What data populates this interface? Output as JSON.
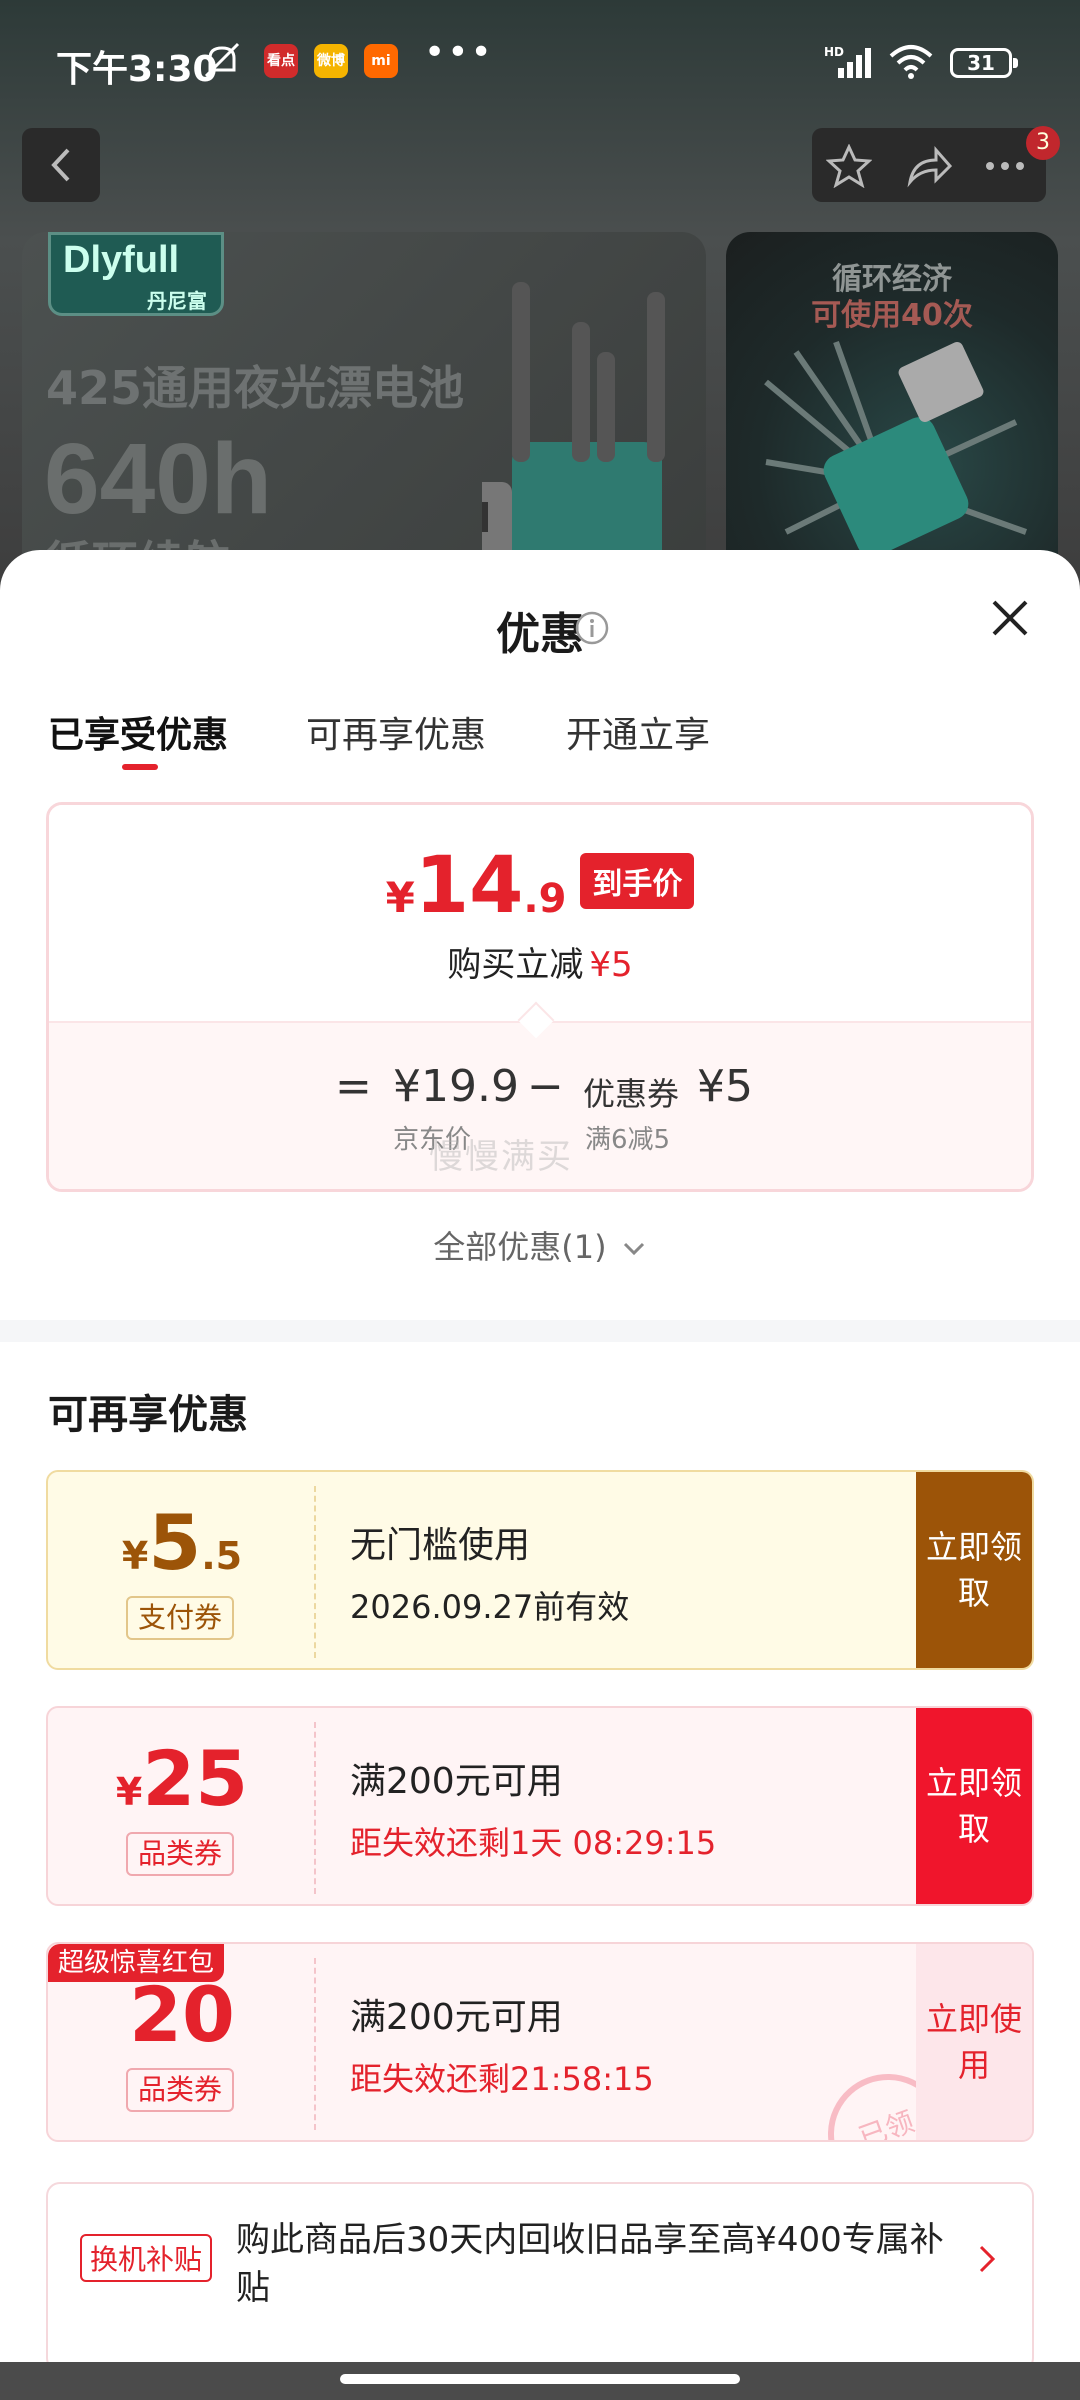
{
  "status_bar": {
    "time": "下午3:30",
    "apps": [
      "看点",
      "微博",
      "mi"
    ],
    "more": "•••",
    "network": "HD",
    "battery": "31"
  },
  "header": {
    "cart_badge": "3"
  },
  "banner": {
    "brand_en": "Dlyfull",
    "brand_cn": "丹尼富",
    "title": "425通用夜光漂电池",
    "hours": "640h",
    "subtitle": "循环续航",
    "side_line1": "循环经济",
    "side_line2": "可使用40次"
  },
  "sheet": {
    "title": "优惠",
    "tabs": [
      "已享受优惠",
      "可再享优惠",
      "开通立享"
    ],
    "summary": {
      "currency": "¥",
      "price_int": "14",
      "price_dec": ".9",
      "price_tag": "到手价",
      "reduce_label": "购买立减",
      "reduce_amount": "¥5",
      "eq": "=",
      "list_price": "¥19.9",
      "minus": "−",
      "coupon_label": "优惠券",
      "coupon_amount": "¥5",
      "list_price_sub": "京东价",
      "coupon_sub": "满6减5",
      "watermark": "慢慢满买"
    },
    "all_discounts": "全部优惠(1)",
    "section_title": "可再享优惠",
    "coupons": [
      {
        "currency": "¥",
        "int": "5",
        "dec": ".5",
        "type": "支付券",
        "condition": "无门槛使用",
        "validity": "2026.09.27前有效",
        "button": "立即领取",
        "corner_tag": ""
      },
      {
        "currency": "¥",
        "int": "25",
        "dec": "",
        "type": "品类券",
        "condition": "满200元可用",
        "validity": "距失效还剩1天 08:29:15",
        "button": "立即领取",
        "corner_tag": ""
      },
      {
        "currency": "",
        "int": "20",
        "dec": "",
        "type": "品类券",
        "condition": "满200元可用",
        "validity": "距失效还剩21:58:15",
        "button": "立即使用",
        "corner_tag": "超级惊喜红包",
        "stamp": "已领"
      }
    ],
    "subsidy": {
      "tag": "换机补贴",
      "text": "购此商品后30天内回收旧品享至高¥400专属补贴"
    }
  },
  "colors": {
    "accent_red": "#e4222c",
    "gold": "#9c5408",
    "pay_coupon_bg": "#fffbe6",
    "coupon_pink_bg": "#fff4f5"
  }
}
